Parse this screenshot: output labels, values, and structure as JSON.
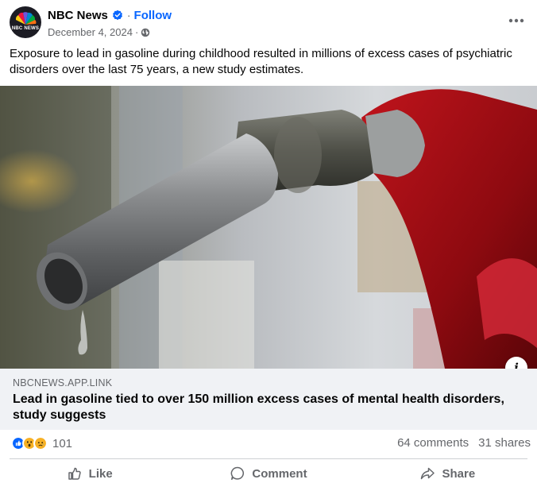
{
  "post": {
    "author": "NBC News",
    "follow_label": "Follow",
    "date": "December 4, 2024",
    "separator": "·",
    "avatar_text": "NBC NEWS",
    "caption": "Exposure to lead in gasoline during childhood resulted in millions of excess cases of psychiatric disorders over the last 75 years, a new study estimates.",
    "info_label": "i"
  },
  "link": {
    "domain": "NBCNEWS.APP.LINK",
    "title": "Lead in gasoline tied to over 150 million excess cases of mental health disorders, study suggests"
  },
  "stats": {
    "reaction_count": "101",
    "reactions": [
      "like",
      "wow",
      "sad"
    ],
    "comments": "64 comments",
    "shares": "31 shares"
  },
  "actions": {
    "like": "Like",
    "comment": "Comment",
    "share": "Share"
  },
  "colors": {
    "brand_blue": "#0866ff",
    "secondary_text": "#65676b",
    "link_bg": "#f0f2f5"
  },
  "icons": [
    "nbc-peacock-icon",
    "verified-badge-icon",
    "globe-icon",
    "more-options-icon",
    "info-icon",
    "like-reaction-icon",
    "wow-reaction-icon",
    "sad-reaction-icon",
    "thumbs-up-icon",
    "comment-icon",
    "share-icon"
  ]
}
